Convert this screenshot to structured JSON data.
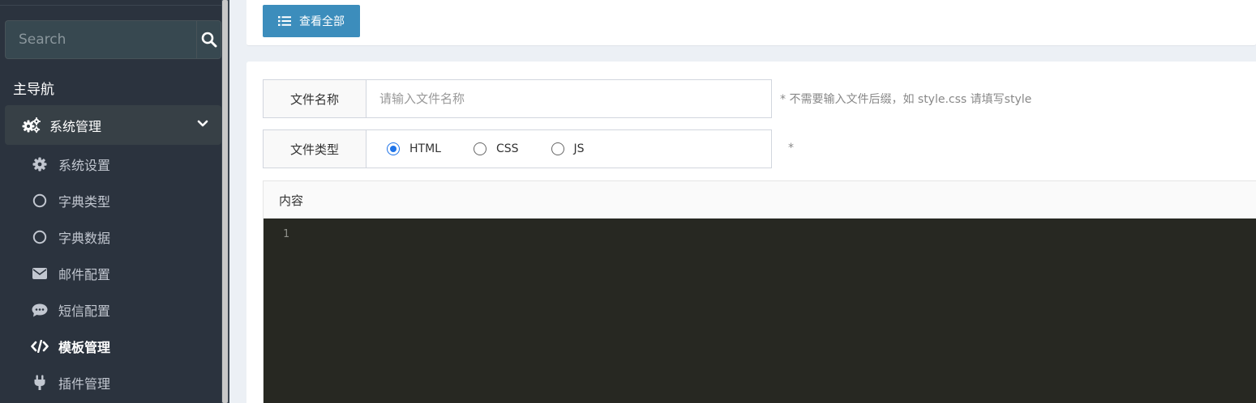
{
  "sidebar": {
    "search": {
      "placeholder": "Search"
    },
    "nav_header": "主导航",
    "parent": {
      "label": "系统管理",
      "icon": "gears-icon"
    },
    "items": [
      {
        "label": "系统设置",
        "icon": "gear-icon",
        "active": false
      },
      {
        "label": "字典类型",
        "icon": "circle-icon",
        "active": false
      },
      {
        "label": "字典数据",
        "icon": "circle-icon",
        "active": false
      },
      {
        "label": "邮件配置",
        "icon": "envelope-icon",
        "active": false
      },
      {
        "label": "短信配置",
        "icon": "comment-icon",
        "active": false
      },
      {
        "label": "模板管理",
        "icon": "code-icon",
        "active": true
      },
      {
        "label": "插件管理",
        "icon": "plug-icon",
        "active": false
      }
    ]
  },
  "toolbar": {
    "view_all_label": "查看全部"
  },
  "form": {
    "file_name": {
      "label": "文件名称",
      "placeholder": "请输入文件名称",
      "value": "",
      "help": "* 不需要输入文件后缀，如 style.css 请填写style"
    },
    "file_type": {
      "label": "文件类型",
      "options": [
        "HTML",
        "CSS",
        "JS"
      ],
      "selected": "HTML",
      "help": "*"
    },
    "content": {
      "label": "内容",
      "line_number": "1"
    }
  },
  "colors": {
    "primary": "#3c8dbc",
    "sidebar_bg": "#2b333e",
    "editor_bg": "#272822",
    "radio_checked": "#1e73e8"
  }
}
